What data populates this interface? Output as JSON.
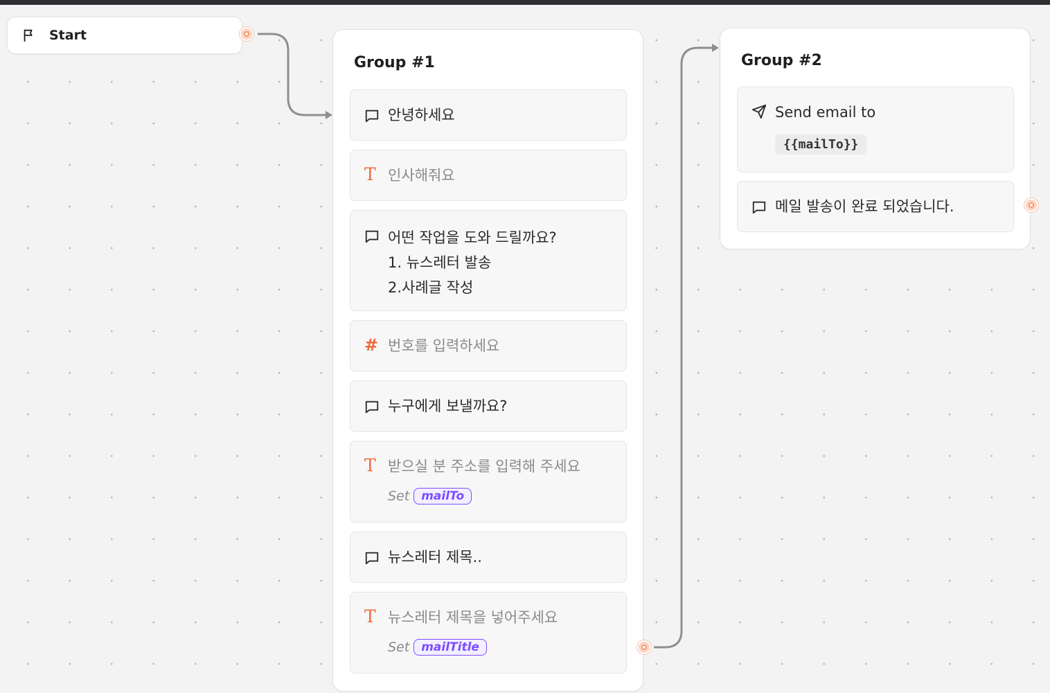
{
  "canvas": {
    "start_node": {
      "label": "Start",
      "icon": "flag-icon"
    },
    "groups": [
      {
        "title": "Group #1",
        "blocks": [
          {
            "type": "text-bubble",
            "icon": "chat-bubble-icon",
            "text": "안녕하세요"
          },
          {
            "type": "text-input",
            "icon": "text-input-icon",
            "placeholder": "인사해줘요"
          },
          {
            "type": "text-bubble",
            "icon": "chat-bubble-icon",
            "lines": [
              "어떤 작업을 도와 드릴까요?",
              "1. 뉴스레터 발송",
              "2.사례글 작성"
            ]
          },
          {
            "type": "number-input",
            "icon": "hash-icon",
            "placeholder": "번호를 입력하세요"
          },
          {
            "type": "text-bubble",
            "icon": "chat-bubble-icon",
            "text": "누구에게 보낼까요?"
          },
          {
            "type": "text-input",
            "icon": "text-input-icon",
            "placeholder": "받으실 분 주소를 입력해 주세요",
            "set_label": "Set",
            "variable": "mailTo"
          },
          {
            "type": "text-bubble",
            "icon": "chat-bubble-icon",
            "text": "뉴스레터 제목.."
          },
          {
            "type": "text-input",
            "icon": "text-input-icon",
            "placeholder": "뉴스레터 제목을 넣어주세요",
            "set_label": "Set",
            "variable": "mailTitle"
          }
        ]
      },
      {
        "title": "Group #2",
        "blocks": [
          {
            "type": "send-email",
            "icon": "send-icon",
            "text": "Send email to",
            "recipient": "{{mailTo}}"
          },
          {
            "type": "text-bubble",
            "icon": "chat-bubble-icon",
            "text": "메일 발송이 완료 되었습니다."
          }
        ]
      }
    ]
  },
  "colors": {
    "accent_orange": "#ef6a3a",
    "variable_purple": "#7c4dff",
    "edge_gray": "#8f8f8f",
    "port_orange": "#f49a6d"
  }
}
